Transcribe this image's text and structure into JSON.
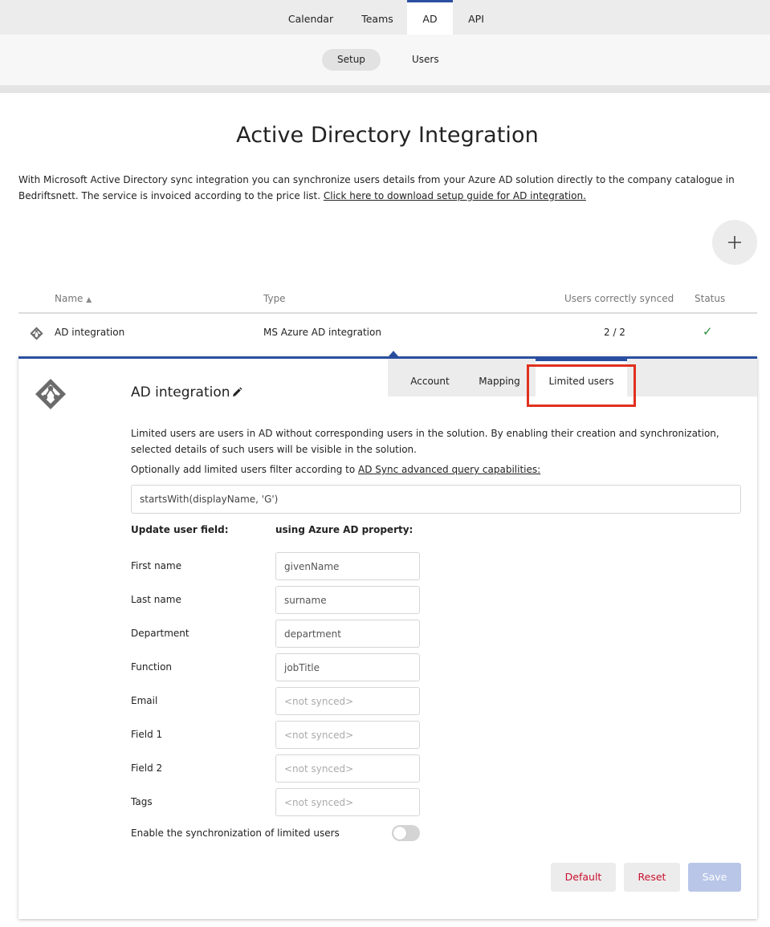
{
  "topnav": {
    "tabs": [
      {
        "label": "Calendar"
      },
      {
        "label": "Teams"
      },
      {
        "label": "AD"
      },
      {
        "label": "API"
      }
    ],
    "active": "AD"
  },
  "subnav": {
    "tabs": [
      {
        "label": "Setup"
      },
      {
        "label": "Users"
      }
    ],
    "active": "Setup"
  },
  "page": {
    "title": "Active Directory Integration",
    "intro_text": "With Microsoft Active Directory sync integration you can synchronize users details from your Azure AD solution directly to the company catalogue in Bedriftsnett. The service is invoiced according to the price list. ",
    "intro_link": "Click here to download setup guide for AD integration.",
    "add_icon": "plus-icon"
  },
  "table": {
    "columns": {
      "name": "Name",
      "type": "Type",
      "synced": "Users correctly synced",
      "status": "Status"
    },
    "sort_indicator": "▲",
    "rows": [
      {
        "icon": "ad-icon",
        "name": "AD integration",
        "type": "MS Azure AD integration",
        "synced": "2 / 2",
        "status": "✓"
      }
    ]
  },
  "panel": {
    "title": "AD integration",
    "edit_icon": "pencil-icon",
    "tabs": [
      {
        "label": "Account"
      },
      {
        "label": "Mapping"
      },
      {
        "label": "Limited users"
      }
    ],
    "active_tab": "Limited users",
    "description": "Limited users are users in AD without corresponding users in the solution. By enabling their creation and synchronization, selected details of such users will be visible in the solution.",
    "optional_text": "Optionally add limited users filter according to ",
    "optional_link": "AD Sync advanced query capabilities:",
    "filter_value": "startsWith(displayName, 'G')",
    "col_field": "Update user field:",
    "col_property": "using Azure AD property:",
    "fields": [
      {
        "label": "First name",
        "value": "givenName",
        "placeholder": "<not synced>"
      },
      {
        "label": "Last name",
        "value": "surname",
        "placeholder": "<not synced>"
      },
      {
        "label": "Department",
        "value": "department",
        "placeholder": "<not synced>"
      },
      {
        "label": "Function",
        "value": "jobTitle",
        "placeholder": "<not synced>"
      },
      {
        "label": "Email",
        "value": "",
        "placeholder": "<not synced>"
      },
      {
        "label": "Field 1",
        "value": "",
        "placeholder": "<not synced>"
      },
      {
        "label": "Field 2",
        "value": "",
        "placeholder": "<not synced>"
      },
      {
        "label": "Tags",
        "value": "",
        "placeholder": "<not synced>"
      }
    ],
    "enable_label": "Enable the synchronization of limited users",
    "enable_on": false,
    "buttons": {
      "default": "Default",
      "reset": "Reset",
      "save": "Save"
    }
  },
  "colors": {
    "accent": "#2a4fa0",
    "danger": "#c8102e",
    "highlight": "#e0301e",
    "success": "#2e8b3a"
  }
}
